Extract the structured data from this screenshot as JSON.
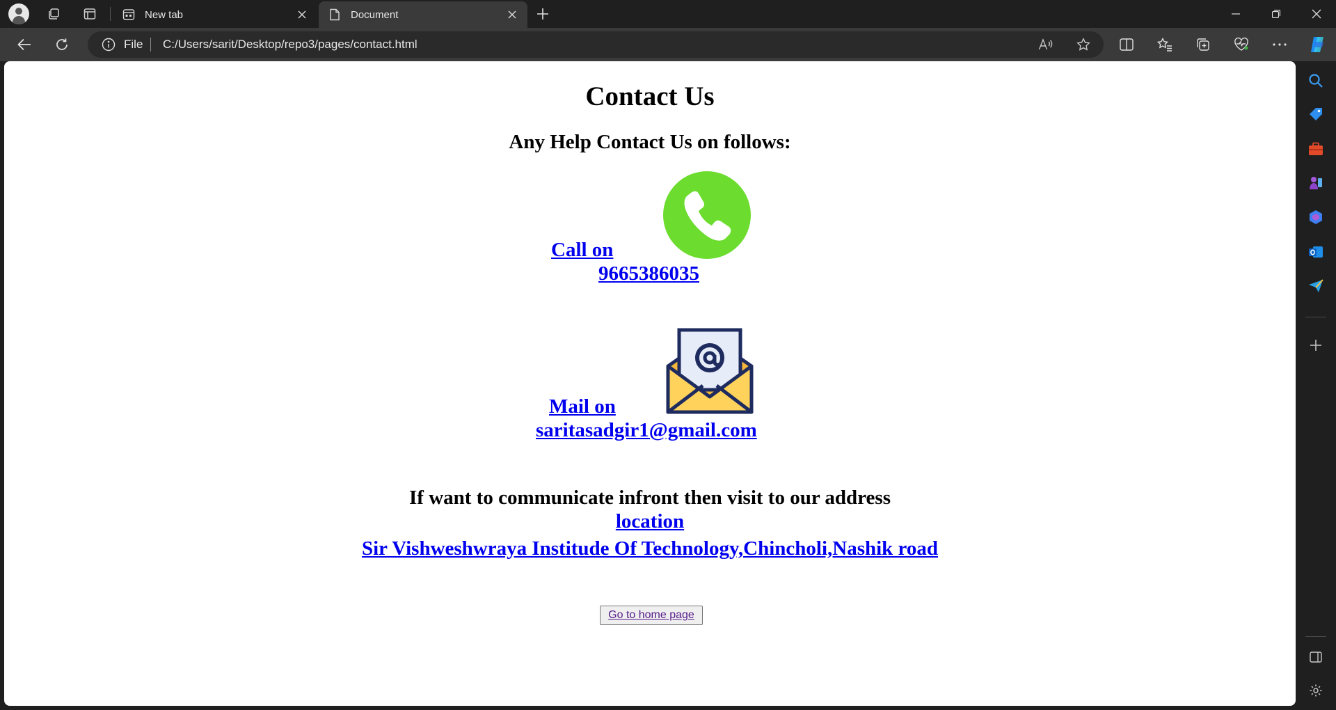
{
  "browser": {
    "tabs": [
      {
        "label": "New tab",
        "active": false
      },
      {
        "label": "Document",
        "active": true
      }
    ],
    "address": {
      "scheme_label": "File",
      "url": "C:/Users/sarit/Desktop/repo3/pages/contact.html"
    },
    "colors": {
      "frame": "#1f1f1f",
      "toolbar": "#3a3a3a",
      "omnibox": "#2a2a2a"
    }
  },
  "page": {
    "title": "Contact Us",
    "subtitle": "Any Help Contact Us on follows:",
    "call": {
      "label": "Call on",
      "number": "9665386035",
      "icon": "phone-icon",
      "icon_color": "#6cdc2f"
    },
    "mail": {
      "label": "Mail on",
      "email": "saritasadgir1@gmail.com",
      "icon": "envelope-icon"
    },
    "address": {
      "intro": "If want to communicate infront then visit to our address",
      "location_label": "location",
      "address_text": "Sir Vishweshwraya Institude Of Technology,Chincholi,Nashik road"
    },
    "home_button": "Go to home page",
    "link_color": "#0000ee"
  }
}
